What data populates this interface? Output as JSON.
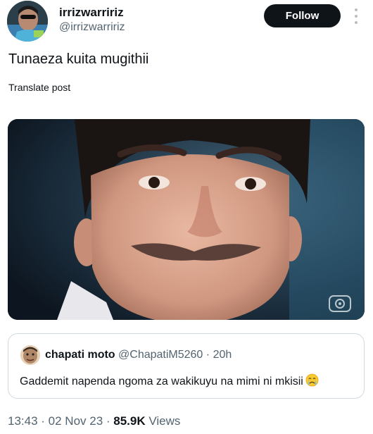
{
  "author": {
    "display_name": "irrizwarririz",
    "handle": "@irrizwarririz"
  },
  "actions": {
    "follow_label": "Follow",
    "more_icon": "more-vertical-icon"
  },
  "tweet": {
    "text": "Tunaeza kuita mugithii",
    "translate_label": "Translate post"
  },
  "media": {
    "watermark_icon": "globo-logo-icon"
  },
  "quote": {
    "display_name": "chapati moto",
    "handle": "@ChapatiM5260",
    "separator": "·",
    "time": "20h",
    "text": "Gaddemit napenda ngoma za wakikuyu na mimi ni mkisii",
    "emoji_icon": "crying-face-icon"
  },
  "meta": {
    "time": "13:43",
    "sep1": " · ",
    "date": "02 Nov 23",
    "sep2": " · ",
    "views_count": "85.9K",
    "views_label": " Views"
  }
}
